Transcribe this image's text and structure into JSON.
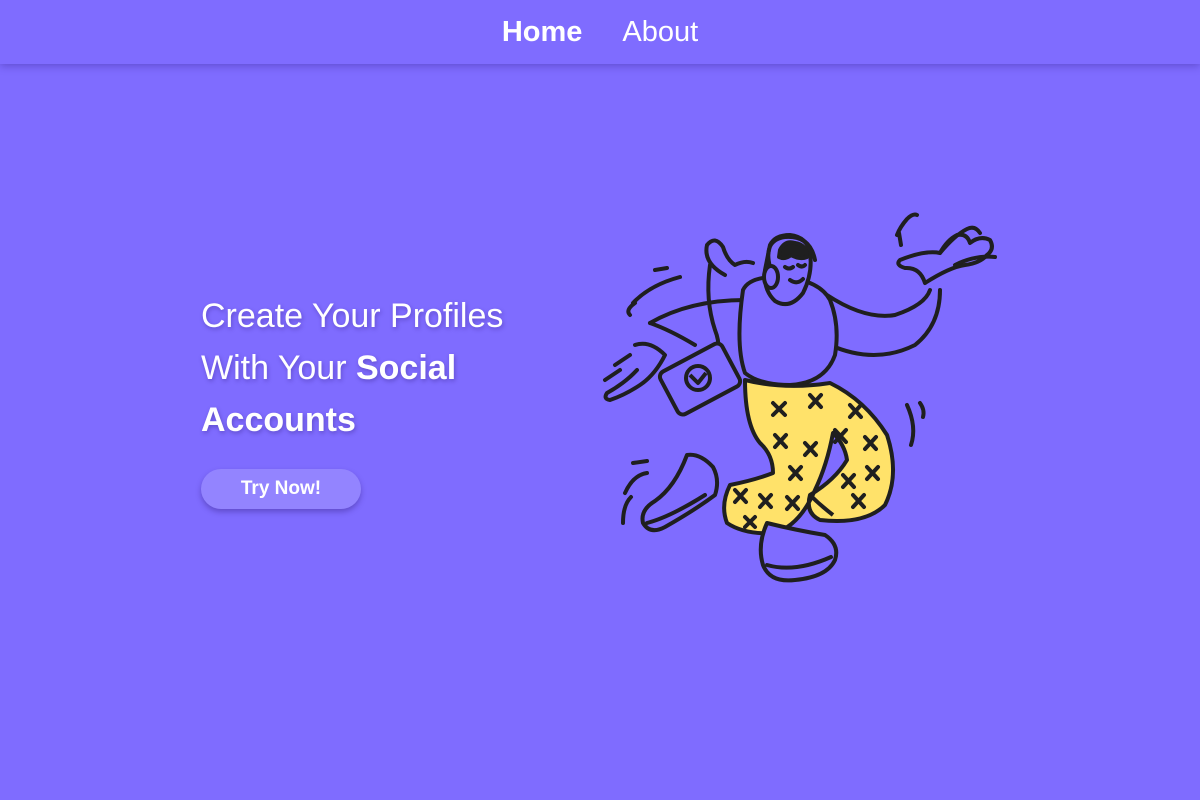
{
  "nav": {
    "home_label": "Home",
    "about_label": "About"
  },
  "hero": {
    "headline_line1": "Create Your Profiles",
    "headline_line2_prefix": "With Your ",
    "headline_line2_bold": "Social",
    "headline_line3_bold": "Accounts",
    "cta_label": "Try Now!"
  },
  "colors": {
    "background": "#7f6cff",
    "button": "#9384ff",
    "text": "#ffffff",
    "pants": "#ffe26a",
    "ink": "#1f1f1f"
  },
  "illustration": {
    "icon": "dancing-person-illustration"
  }
}
